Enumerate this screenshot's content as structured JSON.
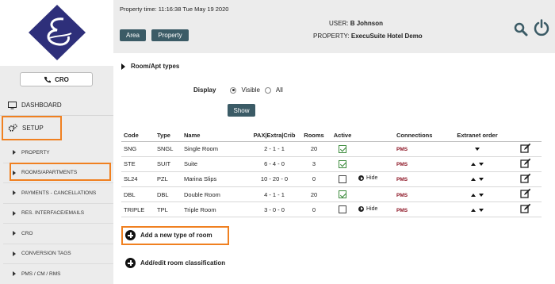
{
  "header": {
    "property_time": "Property time: 11:16:38 Tue May 19 2020",
    "area_btn": "Area",
    "property_btn": "Property",
    "user_label": "USER:",
    "user_value": "B Johnson",
    "property_label": "PROPERTY:",
    "property_value": "ExecuSuite Hotel Demo",
    "icons": [
      "search-icon",
      "power-icon"
    ]
  },
  "sidebar": {
    "cro_button": "CRO",
    "dashboard": "DASHBOARD",
    "setup": "SETUP",
    "items": [
      {
        "label": "PROPERTY"
      },
      {
        "label": "ROOMS/APARTMENTS"
      },
      {
        "label": "PAYMENTS - CANCELLATIONS"
      },
      {
        "label": "RES. INTERFACE/EMAILS"
      },
      {
        "label": "CRO"
      },
      {
        "label": "CONVERSION TAGS"
      },
      {
        "label": "PMS / CM / RMS"
      }
    ]
  },
  "main": {
    "section_title": "Room/Apt types",
    "display_label": "Display",
    "radio_visible": "Visible",
    "radio_all": "All",
    "show_btn": "Show",
    "columns": [
      "Code",
      "Type",
      "Name",
      "PAX|Extra|Crib",
      "Rooms",
      "Active",
      "",
      "Connections",
      "Extranet order",
      ""
    ],
    "rows": [
      {
        "code": "SNG",
        "type": "SNGL",
        "name": "Single Room",
        "pax": "2 - 1 - 1",
        "rooms": "20",
        "active": true,
        "hide": "",
        "conn": "PMS",
        "order": "down"
      },
      {
        "code": "STE",
        "type": "SUIT",
        "name": "Suite",
        "pax": "6 - 4 - 0",
        "rooms": "3",
        "active": true,
        "hide": "",
        "conn": "PMS",
        "order": "updown"
      },
      {
        "code": "SL24",
        "type": "PZL",
        "name": "Marina Slips",
        "pax": "10 - 20 - 0",
        "rooms": "0",
        "active": false,
        "hide": "Hide",
        "conn": "PMS",
        "order": "updown"
      },
      {
        "code": "DBL",
        "type": "DBL",
        "name": "Double Room",
        "pax": "4 - 1 - 1",
        "rooms": "20",
        "active": true,
        "hide": "",
        "conn": "PMS",
        "order": "updown"
      },
      {
        "code": "TRIPLE",
        "type": "TPL",
        "name": "Triple Room",
        "pax": "3 - 0 - 0",
        "rooms": "0",
        "active": false,
        "hide": "Hide",
        "conn": "PMS",
        "order": "updown"
      }
    ],
    "add_new": "Add a new type of room",
    "add_class": "Add/edit room classification"
  },
  "colors": {
    "accent": "#3b5b66",
    "highlight": "#f08020",
    "pms": "#8a1020",
    "logo": "#2e2f7a"
  }
}
